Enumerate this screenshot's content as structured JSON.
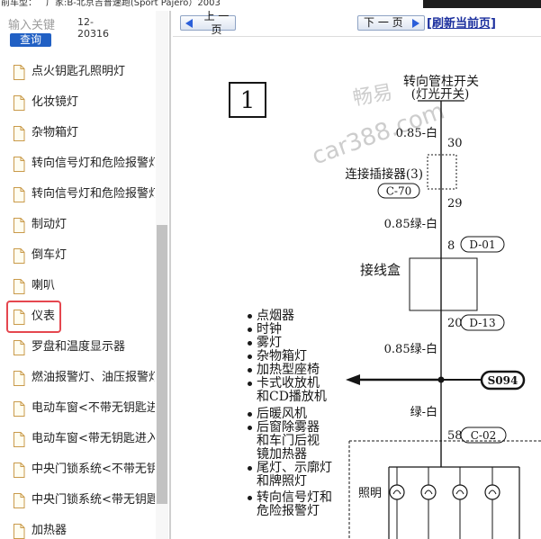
{
  "header": {
    "model_label": "前车型：",
    "model_value": "厂家:B-北京吉普速跑(Sport Pajero）2003"
  },
  "search": {
    "placeholder": "输入关键",
    "button_label": "查询",
    "code": "12-20316"
  },
  "sidebar": {
    "items": [
      {
        "label": "点火钥匙孔照明灯"
      },
      {
        "label": "化妆镜灯"
      },
      {
        "label": "杂物箱灯"
      },
      {
        "label": "转向信号灯和危险报警灯"
      },
      {
        "label": "转向信号灯和危险报警灯"
      },
      {
        "label": "制动灯"
      },
      {
        "label": "倒车灯"
      },
      {
        "label": "喇叭"
      },
      {
        "label": "仪表",
        "selected": true
      },
      {
        "label": "罗盘和温度显示器"
      },
      {
        "label": "燃油报警灯、油压报警灯"
      },
      {
        "label": "电动车窗<不带无钥匙进"
      },
      {
        "label": "电动车窗<带无钥匙进入"
      },
      {
        "label": "中央门锁系统<不带无钥"
      },
      {
        "label": "中央门锁系统<带无钥匙"
      },
      {
        "label": "加热器"
      }
    ]
  },
  "nav": {
    "prev_label": "上 一 页",
    "next_label": "下 一 页",
    "refresh_label": "[刷新当前页]"
  },
  "diagram": {
    "page_number": "1",
    "switch_name": "转向管柱开关",
    "switch_sub": "(灯光开关)",
    "wire_1": "0.85-白",
    "pin_30": "30",
    "connector_label": "连接插接器(3)",
    "connector_code": "C-70",
    "pin_29": "29",
    "wire_2": "0.85绿-白",
    "pin_8": "8",
    "code_d01": "D-01",
    "junction_box_label": "接线盒",
    "pin_20": "20",
    "code_d13": "D-13",
    "wire_3": "0.85绿-白",
    "splice": "S094",
    "wire_4": "绿-白",
    "pin_58": "58",
    "code_c02": "C-02",
    "lighting_label": "照明",
    "loads": [
      [
        "点烟器"
      ],
      [
        "时钟"
      ],
      [
        "雾灯"
      ],
      [
        "杂物箱灯"
      ],
      [
        "加热型座椅"
      ],
      [
        "卡式收放机",
        "和CD播放机"
      ],
      [
        "后暖风机"
      ],
      [
        "后窗除雾器",
        "和车门后视",
        "镜加热器"
      ],
      [
        "尾灯、示廓灯",
        "和牌照灯"
      ],
      [
        "转向信号灯和",
        "危险报警灯"
      ]
    ]
  },
  "watermark": {
    "line1": "畅易",
    "line2": "car388.com"
  },
  "icons": {
    "prev": "arrow-left-icon",
    "next": "arrow-right-icon",
    "list_item": "document-icon"
  },
  "colors": {
    "selected_border": "#e5474f",
    "link": "#1b2f9e",
    "button": "#2160c4",
    "arrow": "#2b5fd9"
  }
}
